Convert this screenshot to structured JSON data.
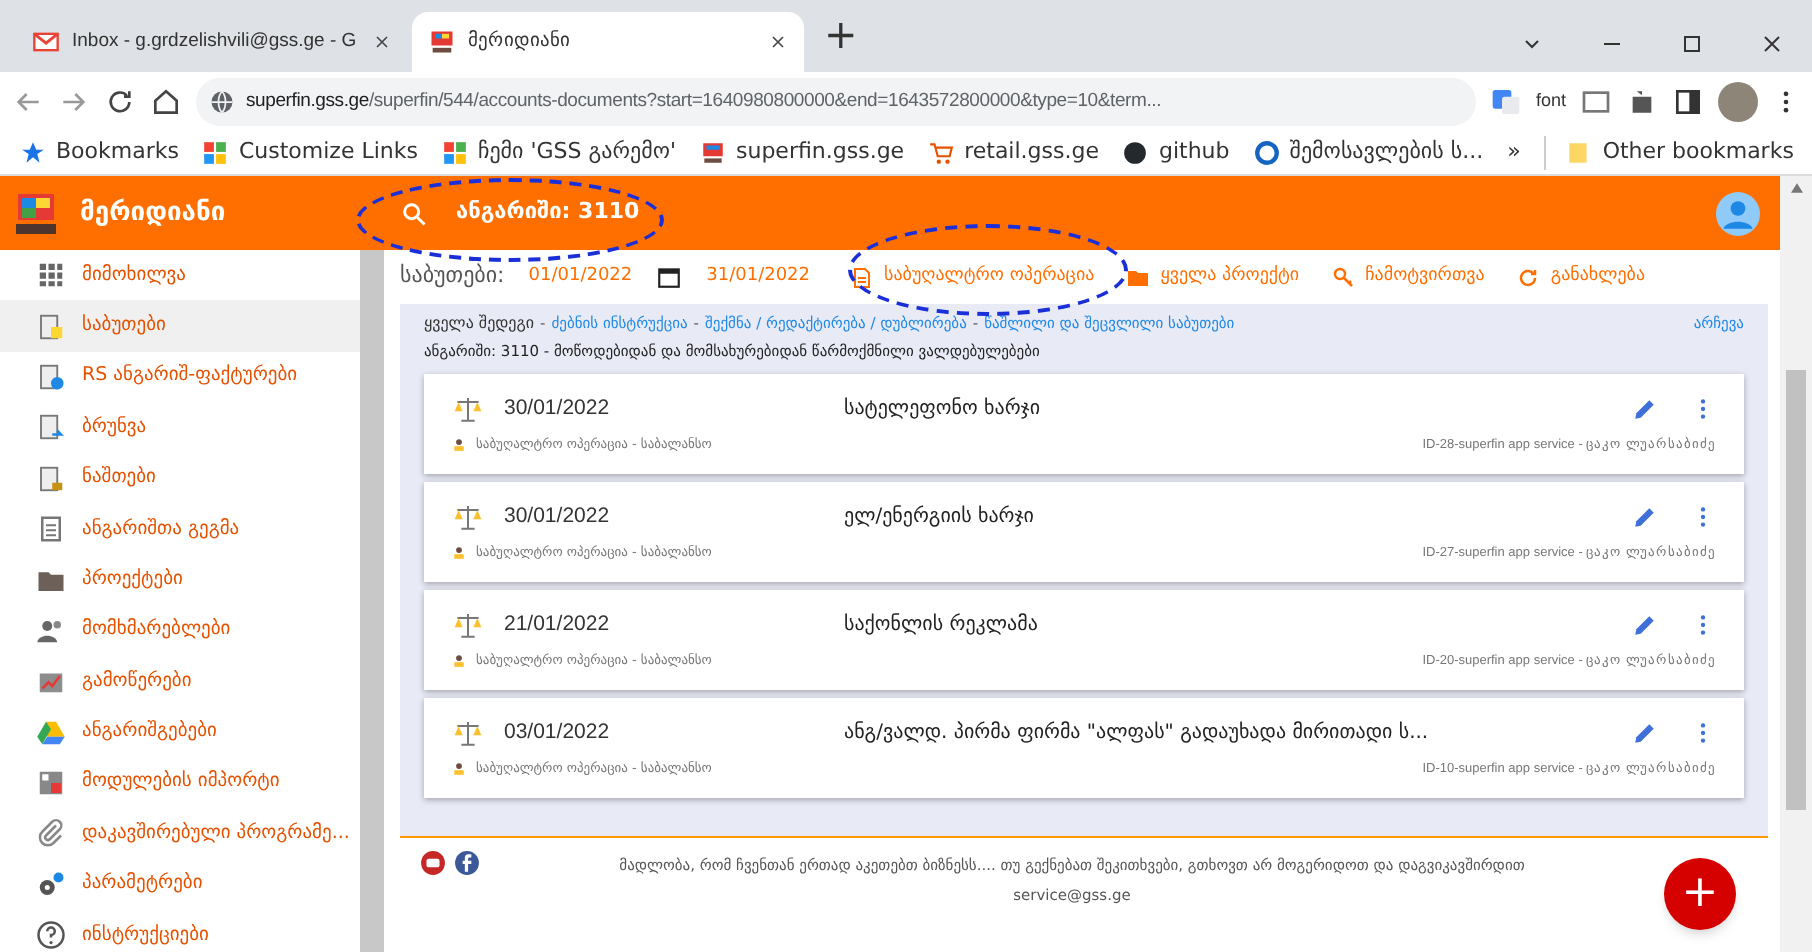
{
  "browser": {
    "tabs": [
      {
        "label": "Inbox - g.grdzelishvili@gss.ge - G",
        "selected": false
      },
      {
        "label": "მერიდიანი",
        "selected": true
      }
    ],
    "new_tab": "+",
    "url_host": "superfin.gss.ge",
    "url_path": "/superfin/544/accounts-documents?start=1640980800000&end=1643572800000&type=10&term...",
    "extension_label": "font",
    "bookmarks": [
      "Bookmarks",
      "Customize Links",
      "ჩემი 'GSS გარემო'",
      "superfin.gss.ge",
      "retail.gss.ge",
      "github",
      "შემოსავლების ს..."
    ],
    "more_bookmarks": "»",
    "other_bookmarks": "Other bookmarks"
  },
  "app": {
    "title": "მერიდიანი",
    "search": "ანგარიში: 3110"
  },
  "sidebar": {
    "items": [
      {
        "label": "მიმოხილვა",
        "selected": false
      },
      {
        "label": "საბუთები",
        "selected": true
      },
      {
        "label": "RS ანგარიშ-ფაქტურები",
        "selected": false
      },
      {
        "label": "ბრუნვა",
        "selected": false
      },
      {
        "label": "ნაშთები",
        "selected": false
      },
      {
        "label": "ანგარიშთა გეგმა",
        "selected": false
      },
      {
        "label": "პროექტები",
        "selected": false
      },
      {
        "label": "მომხმარებლები",
        "selected": false
      },
      {
        "label": "გამოწერები",
        "selected": false
      },
      {
        "label": "ანგარიშგებები",
        "selected": false
      },
      {
        "label": "მოდულების იმპორტი",
        "selected": false
      },
      {
        "label": "დაკავშირებული პროგრამე...",
        "selected": false
      },
      {
        "label": "პარამეტრები",
        "selected": false
      },
      {
        "label": "ინსტრუქციები",
        "selected": false
      }
    ]
  },
  "toolbar": {
    "label": "საბუთები:",
    "date_from": "01/01/2022",
    "date_to": "31/01/2022",
    "actions": [
      "საბუღალტრო ოპერაცია",
      "ყველა პროექტი",
      "ჩამოტვირთვა",
      "განახლება"
    ]
  },
  "filter": {
    "links": [
      "ყველა შედეგი",
      "ძებნის ინსტრუქცია",
      "შექმნა / რედაქტირება / დუბლირება",
      "წაშლილი და შეცვლილი საბუთები"
    ],
    "separator": "-",
    "select": "არჩევა",
    "account": "ანგარიში: 3110 - მოწოდებიდან და მომსახურებიდან წარმოქმნილი ვალდებულებები"
  },
  "documents": [
    {
      "date": "30/01/2022",
      "title": "სატელეფონო ხარჯი",
      "type": "საბუღალტრო ოპერაცია - საბალანსო",
      "author": "ID-28-superfin app service - ცაკო ლუარსაბიძე"
    },
    {
      "date": "30/01/2022",
      "title": "ელ/ენერგიის ხარჯი",
      "type": "საბუღალტრო ოპერაცია - საბალანსო",
      "author": "ID-27-superfin app service - ცაკო ლუარსაბიძე"
    },
    {
      "date": "21/01/2022",
      "title": "საქონლის რეკლამა",
      "type": "საბუღალტრო ოპერაცია - საბალანსო",
      "author": "ID-20-superfin app service - ცაკო ლუარსაბიძე"
    },
    {
      "date": "03/01/2022",
      "title": "ანგ/ვალდ. პირმა ფირმა \"ალფას\" გადაუხადა მირითადი ს...",
      "type": "საბუღალტრო ოპერაცია - საბალანსო",
      "author": "ID-10-superfin app service - ცაკო ლუარსაბიძე"
    }
  ],
  "footer": {
    "text": "მადლობა, რომ ჩვენთან ერთად აკეთებთ ბიზნესს.... თუ გექნებათ შეკითხვები, გთხოვთ არ მოგერიდოთ და დაგვიკავშირდით service@gss.ge",
    "fab": "+"
  }
}
